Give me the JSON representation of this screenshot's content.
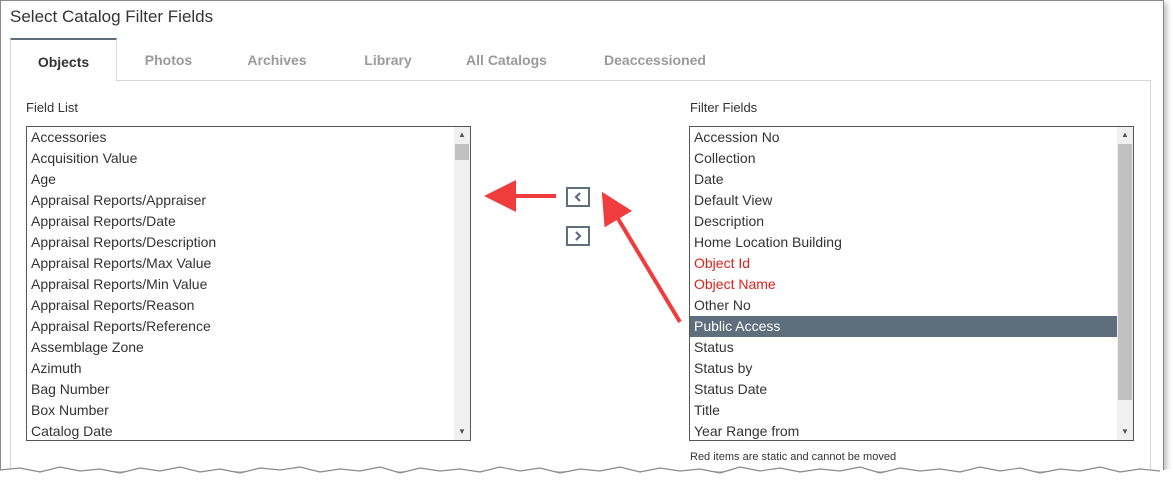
{
  "title": "Select Catalog Filter Fields",
  "tabs": [
    {
      "label": "Objects",
      "active": true
    },
    {
      "label": "Photos",
      "active": false
    },
    {
      "label": "Archives",
      "active": false
    },
    {
      "label": "Library",
      "active": false
    },
    {
      "label": "All Catalogs",
      "active": false
    },
    {
      "label": "Deaccessioned",
      "active": false
    }
  ],
  "field_list": {
    "label": "Field List",
    "items": [
      "Accessories",
      "Acquisition Value",
      "Age",
      "Appraisal Reports/Appraiser",
      "Appraisal Reports/Date",
      "Appraisal Reports/Description",
      "Appraisal Reports/Max Value",
      "Appraisal Reports/Min Value",
      "Appraisal Reports/Reason",
      "Appraisal Reports/Reference",
      "Assemblage Zone",
      "Azimuth",
      "Bag Number",
      "Box Number",
      "Catalog Date"
    ]
  },
  "filter_fields": {
    "label": "Filter Fields",
    "items": [
      {
        "label": "Accession No",
        "static": false,
        "selected": false
      },
      {
        "label": "Collection",
        "static": false,
        "selected": false
      },
      {
        "label": "Date",
        "static": false,
        "selected": false
      },
      {
        "label": "Default View",
        "static": false,
        "selected": false
      },
      {
        "label": "Description",
        "static": false,
        "selected": false
      },
      {
        "label": "Home Location Building",
        "static": false,
        "selected": false
      },
      {
        "label": "Object Id",
        "static": true,
        "selected": false
      },
      {
        "label": "Object Name",
        "static": true,
        "selected": false
      },
      {
        "label": "Other No",
        "static": false,
        "selected": false
      },
      {
        "label": "Public Access",
        "static": false,
        "selected": true
      },
      {
        "label": "Status",
        "static": false,
        "selected": false
      },
      {
        "label": "Status by",
        "static": false,
        "selected": false
      },
      {
        "label": "Status Date",
        "static": false,
        "selected": false
      },
      {
        "label": "Title",
        "static": false,
        "selected": false
      },
      {
        "label": "Year Range from",
        "static": false,
        "selected": false
      }
    ],
    "note": "Red items are static and cannot be moved"
  },
  "icons": {
    "move_left": "chevron-left-icon",
    "move_right": "chevron-right-icon"
  },
  "colors": {
    "accent": "#5e6e7d",
    "static_item": "#e0201a",
    "annotation_arrow": "#f03c3c"
  }
}
